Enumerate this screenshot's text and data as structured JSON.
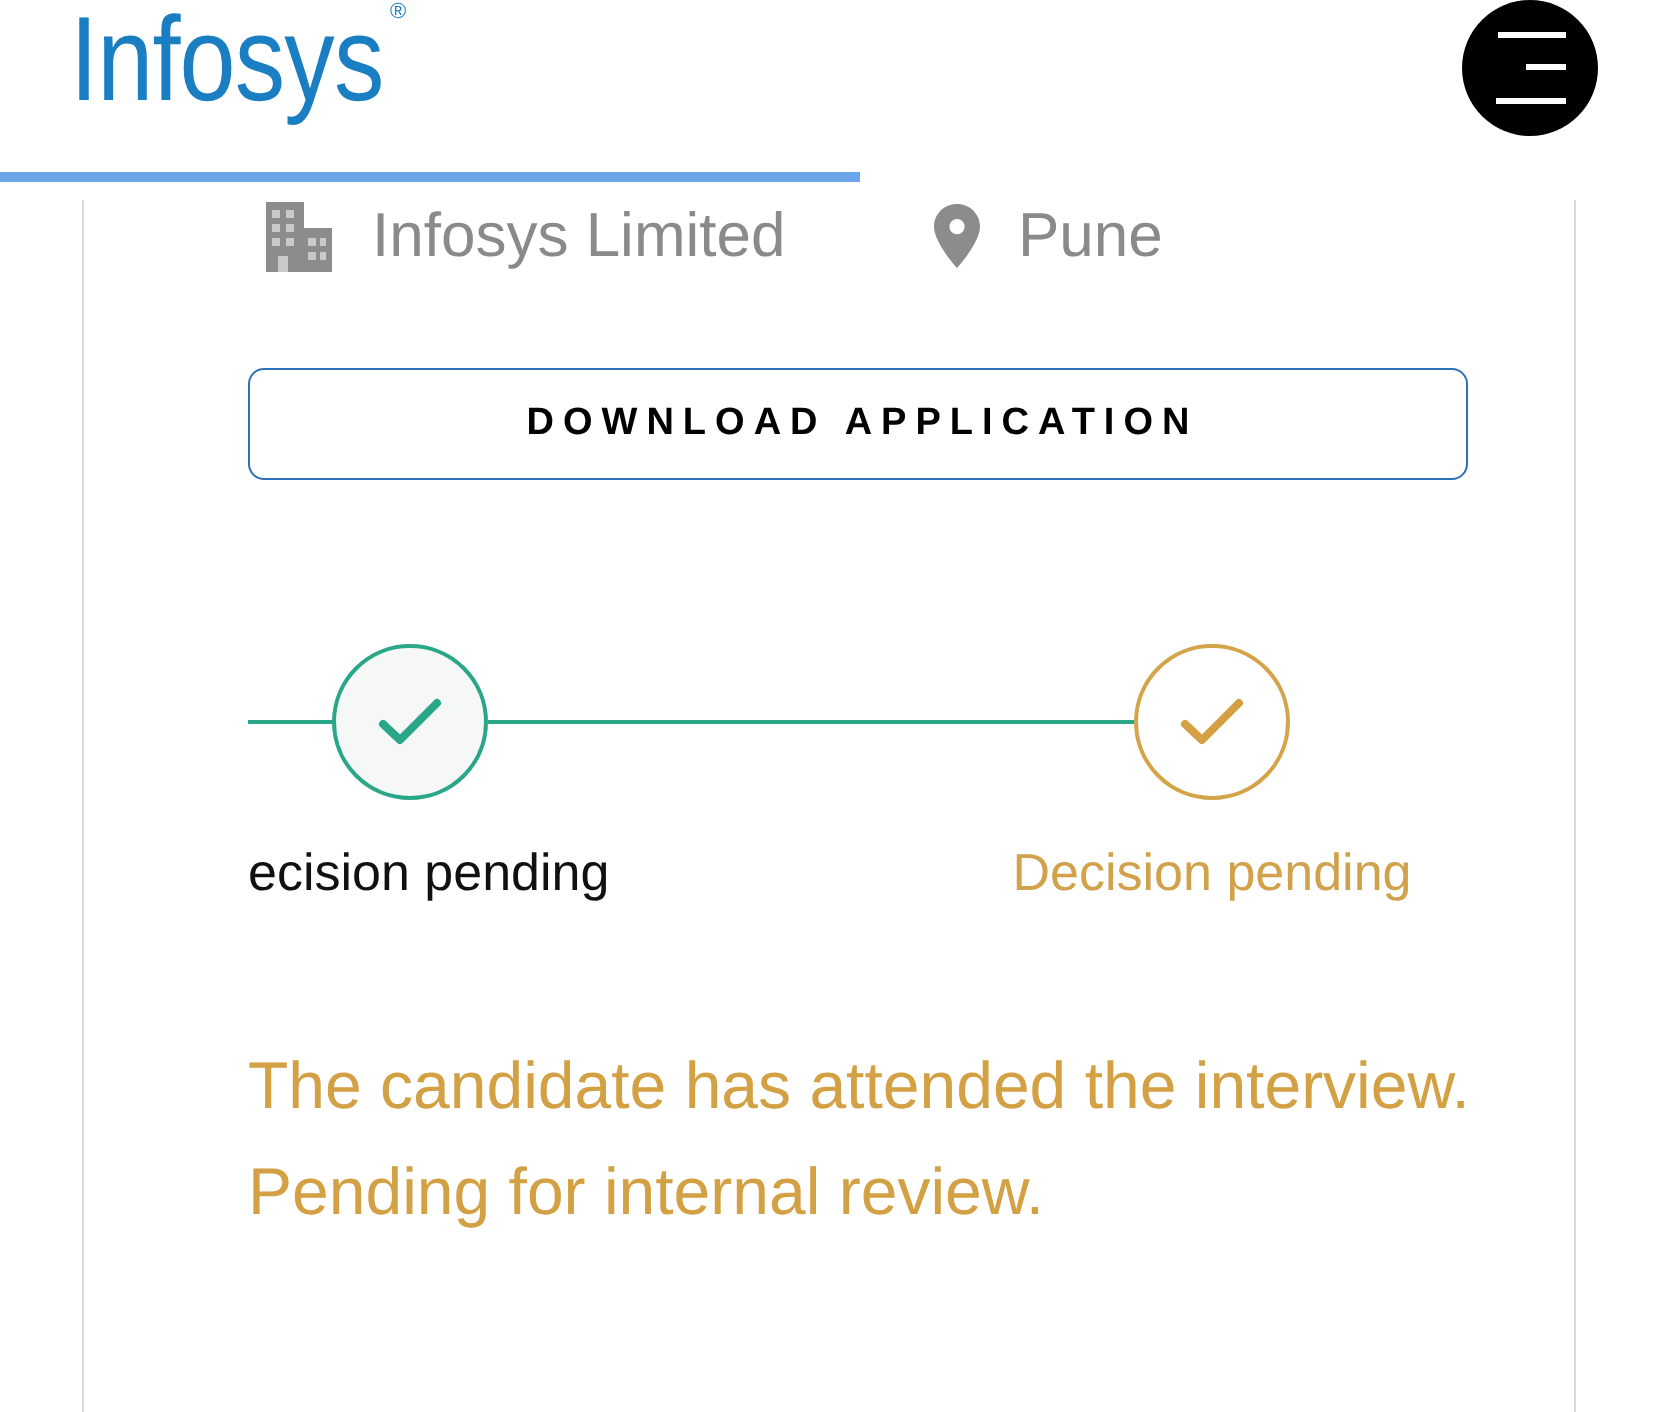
{
  "header": {
    "logo": {
      "text": "Infosys",
      "mark": "®"
    }
  },
  "company": {
    "name": "Infosys Limited",
    "location": "Pune"
  },
  "download_button": {
    "label": "DOWNLOAD APPLICATION"
  },
  "stepper": {
    "steps": [
      {
        "label": "ecision pending",
        "kind": "done"
      },
      {
        "label": "Decision pending",
        "kind": "pending"
      }
    ]
  },
  "message": {
    "lines": [
      "The candidate has attended the interview.",
      "Pending for internal review."
    ]
  }
}
